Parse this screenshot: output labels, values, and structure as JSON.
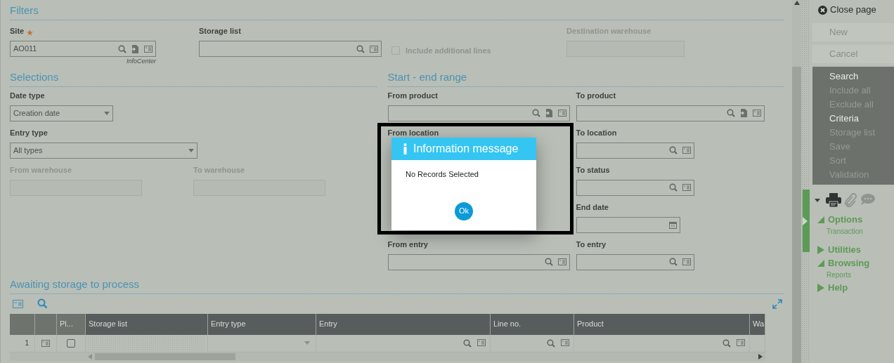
{
  "filters": {
    "title": "Filters",
    "fields": [
      {
        "kind": "lookup_import",
        "label": "Site",
        "required": true,
        "value": "AO011",
        "note": "InfoCenter",
        "disabled": false
      },
      {
        "kind": "lookup",
        "label": "Storage list",
        "required": false,
        "disabled": false
      },
      {
        "kind": "checkbox",
        "label": "Include additional lines",
        "checked": false,
        "disabled": true
      },
      {
        "kind": "plain",
        "label": "Destination warehouse",
        "required": false,
        "disabled": true
      }
    ]
  },
  "selections": {
    "title": "Selections",
    "fields": [
      {
        "kind": "select",
        "label": "Date type",
        "value": "Creation date",
        "disabled": false
      },
      {
        "kind": "select",
        "label": "Entry type",
        "value": "All types",
        "disabled": false
      },
      {
        "kind": "plain",
        "label": "From warehouse",
        "disabled": true
      },
      {
        "kind": "plain",
        "label": "To warehouse",
        "disabled": true
      }
    ]
  },
  "range": {
    "title": "Start - end range",
    "rows": [
      {
        "left": {
          "kind": "lookup_import",
          "label": "From product",
          "disabled": false
        },
        "right": {
          "kind": "lookup_import",
          "label": "To product",
          "disabled": false
        }
      },
      {
        "left": {
          "kind": "covered",
          "label": "From location"
        },
        "right": {
          "kind": "lookup",
          "label": "To location",
          "disabled": false
        }
      },
      {
        "right": {
          "kind": "lookup",
          "label": "To status",
          "disabled": false
        }
      },
      {
        "right": {
          "kind": "date",
          "label": "End date",
          "disabled": false
        }
      },
      {
        "left": {
          "kind": "lookup",
          "label": "From entry",
          "disabled": false
        },
        "right": {
          "kind": "lookup",
          "label": "To entry",
          "disabled": false
        }
      }
    ]
  },
  "grid": {
    "title": "Awaiting storage to process",
    "columns": [
      {
        "kind": "fixed"
      },
      {
        "kind": "fixed"
      },
      {
        "kind": "fixed",
        "label": "Pl..."
      },
      {
        "kind": "data",
        "label": "Storage list"
      },
      {
        "kind": "data",
        "label": "Entry type"
      },
      {
        "kind": "data",
        "label": "Entry"
      },
      {
        "kind": "data",
        "label": "Line no."
      },
      {
        "kind": "data",
        "label": "Product"
      },
      {
        "kind": "data",
        "label": "Wa"
      }
    ],
    "rows": [
      {
        "number": "1",
        "checked": false
      }
    ]
  },
  "dialog": {
    "title": "Information message",
    "message": "No Records Selected",
    "button": "Ok"
  },
  "sidebar": {
    "close": "Close page",
    "buttons": [
      {
        "label": "New",
        "disabled": true
      },
      {
        "label": "Cancel",
        "disabled": true
      }
    ],
    "menu": [
      {
        "label": "Search",
        "disabled": false
      },
      {
        "label": "Include all",
        "disabled": true
      },
      {
        "label": "Exclude all",
        "disabled": true
      },
      {
        "label": "Criteria",
        "disabled": false
      },
      {
        "label": "Storage list",
        "disabled": true
      },
      {
        "label": "Save",
        "disabled": true
      },
      {
        "label": "Sort",
        "disabled": true
      },
      {
        "label": "Validation",
        "disabled": true
      }
    ],
    "sections": [
      {
        "label": "Options",
        "expanded": true,
        "items": [
          "Transaction"
        ]
      },
      {
        "label": "Utilities",
        "expanded": false
      },
      {
        "label": "Browsing",
        "expanded": true,
        "items": [
          "Reports"
        ]
      },
      {
        "label": "Help",
        "expanded": false
      }
    ]
  }
}
